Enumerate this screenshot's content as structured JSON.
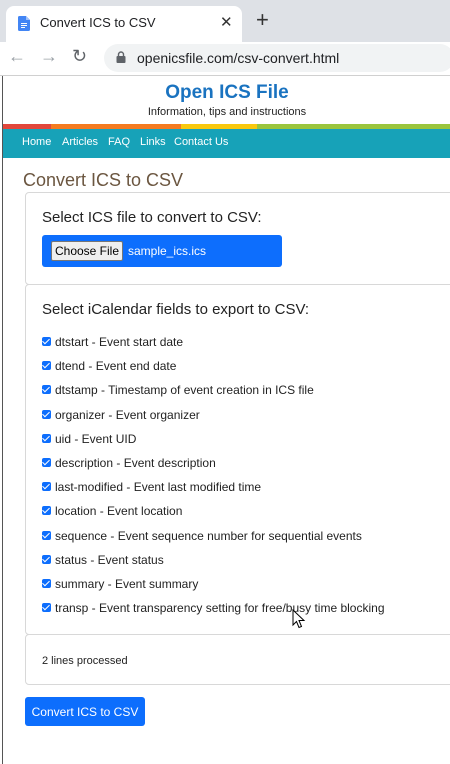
{
  "browser": {
    "tab_title": "Convert ICS to CSV",
    "close_glyph": "✕",
    "new_tab_glyph": "+",
    "url": "openicsfile.com/csv-convert.html",
    "back_glyph": "←",
    "forward_glyph": "→",
    "reload_glyph": "↻"
  },
  "site": {
    "title": "Open ICS File",
    "tagline": "Information, tips and instructions",
    "stripe_colors": [
      "#e2473b",
      "#f47b20",
      "#f9c80e",
      "#9bc53d"
    ],
    "accent": "#17a2b8",
    "nav": [
      "Home",
      "Articles",
      "FAQ",
      "Links",
      "Contact Us"
    ]
  },
  "main": {
    "heading": "Convert ICS to CSV",
    "file_card": {
      "title": "Select ICS file to convert to CSV:",
      "button_label": "Choose File",
      "file_name": "sample_ics.ics"
    },
    "fields_card": {
      "title": "Select iCalendar fields to export to CSV:",
      "fields": [
        {
          "label": "dtstart - Event start date",
          "checked": true
        },
        {
          "label": "dtend - Event end date",
          "checked": true
        },
        {
          "label": "dtstamp - Timestamp of event creation in ICS file",
          "checked": true
        },
        {
          "label": "organizer - Event organizer",
          "checked": true
        },
        {
          "label": "uid - Event UID",
          "checked": true
        },
        {
          "label": "description - Event description",
          "checked": true
        },
        {
          "label": "last-modified - Event last modified time",
          "checked": true
        },
        {
          "label": "location - Event location",
          "checked": true
        },
        {
          "label": "sequence - Event sequence number for sequential events",
          "checked": true
        },
        {
          "label": "status - Event status",
          "checked": true
        },
        {
          "label": "summary - Event summary",
          "checked": true
        },
        {
          "label": "transp - Event transparency setting for free/busy time blocking",
          "checked": true
        }
      ]
    },
    "status": "2 lines processed",
    "convert_button": "Convert ICS to CSV"
  }
}
